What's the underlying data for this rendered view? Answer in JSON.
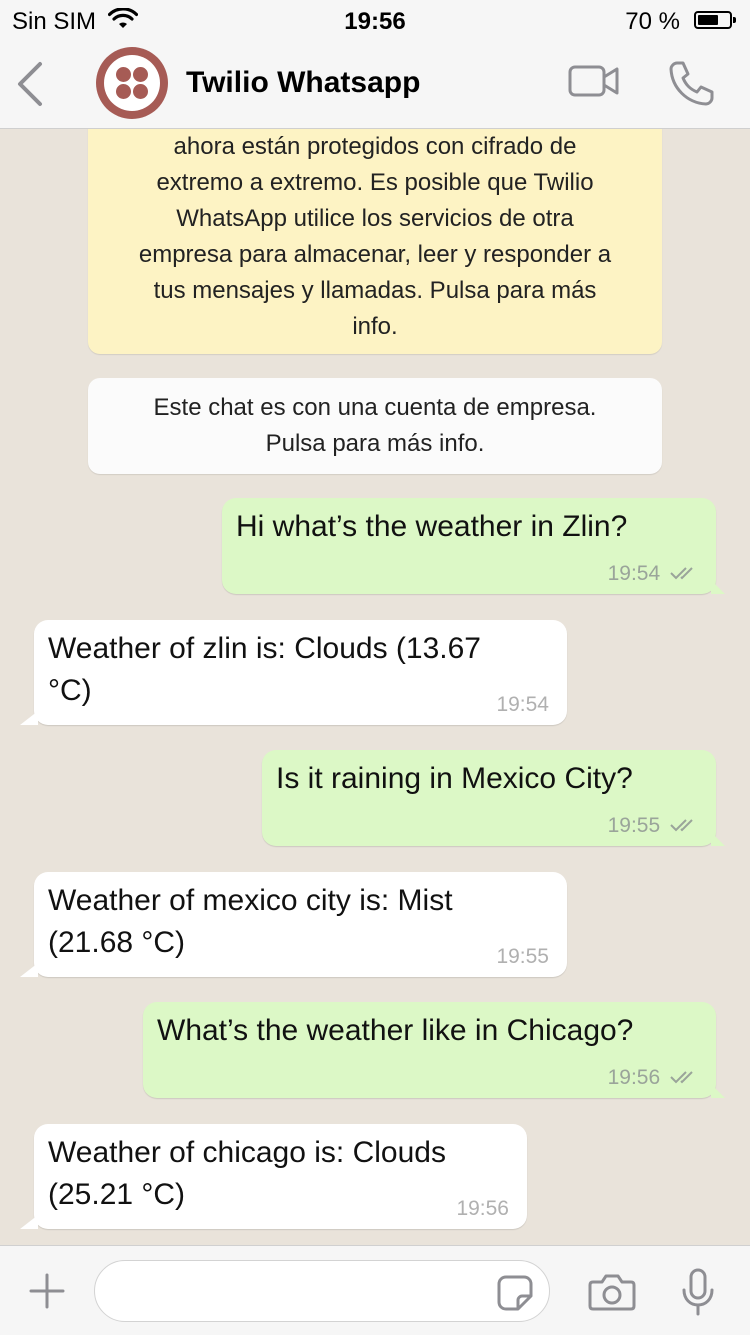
{
  "status_bar": {
    "carrier": "Sin SIM",
    "time": "19:56",
    "battery_percent_label": "70 %",
    "battery_level": 0.7
  },
  "header": {
    "contact_name": "Twilio Whatsapp",
    "avatar_icon": "twilio-logo-icon",
    "back_icon": "chevron-left-icon",
    "video_icon": "video-camera-icon",
    "call_icon": "phone-icon"
  },
  "chat": {
    "encryption_notice": [
      "ahora están protegidos con cifrado de",
      "extremo a extremo. Es posible que Twilio",
      "WhatsApp utilice los servicios de otra",
      "empresa para almacenar, leer y responder a",
      "tus mensajes y llamadas. Pulsa para más",
      "info."
    ],
    "business_notice": [
      "Este chat es con una cuenta de empresa.",
      "Pulsa para más info."
    ],
    "messages": [
      {
        "direction": "out",
        "text": "Hi what’s the weather in Zlin?",
        "time": "19:54",
        "status": "read"
      },
      {
        "direction": "in",
        "text": "Weather of zlin is: Clouds (13.67\n°C)",
        "time": "19:54"
      },
      {
        "direction": "out",
        "text": "Is it raining in Mexico City?",
        "time": "19:55",
        "status": "read"
      },
      {
        "direction": "in",
        "text": "Weather of mexico city is: Mist\n(21.68 °C)",
        "time": "19:55"
      },
      {
        "direction": "out",
        "text": "What’s the weather like in Chicago?",
        "time": "19:56",
        "status": "read"
      },
      {
        "direction": "in",
        "text": "Weather of chicago is: Clouds\n(25.21 °C)",
        "time": "19:56"
      }
    ]
  },
  "input_bar": {
    "placeholder": "",
    "plus_icon": "plus-icon",
    "sticker_icon": "sticker-icon",
    "camera_icon": "camera-icon",
    "mic_icon": "microphone-icon"
  },
  "colors": {
    "outgoing_bubble": "#dcf8c6",
    "incoming_bubble": "#ffffff",
    "encryption_notice_bg": "#fdf3c4",
    "chat_background": "#e9e3da",
    "icon_gray": "#8e8e93",
    "twilio_red": "#a65b55"
  }
}
